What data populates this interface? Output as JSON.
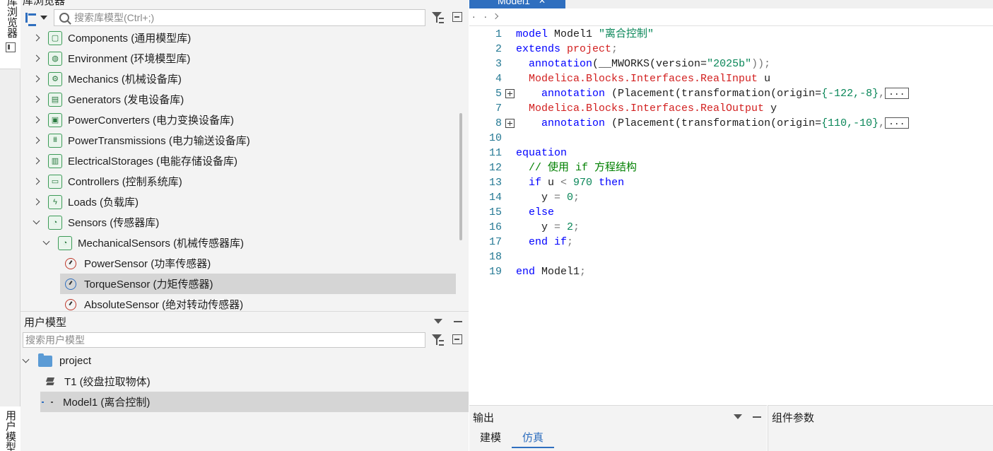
{
  "left_tabs": {
    "library_browser": "库浏览器",
    "user_models": "用户模型"
  },
  "library": {
    "title": "库浏览器",
    "search_placeholder": "搜索库模型(Ctrl+;)",
    "items": [
      {
        "label": "Components (通用模型库)",
        "icon": "components-lib-icon",
        "state": "collapsed"
      },
      {
        "label": "Environment (环境模型库)",
        "icon": "environment-lib-icon",
        "state": "collapsed"
      },
      {
        "label": "Mechanics (机械设备库)",
        "icon": "mechanics-lib-icon",
        "state": "collapsed"
      },
      {
        "label": "Generators (发电设备库)",
        "icon": "generators-lib-icon",
        "state": "collapsed"
      },
      {
        "label": "PowerConverters (电力变换设备库)",
        "icon": "powerconverters-lib-icon",
        "state": "collapsed"
      },
      {
        "label": "PowerTransmissions (电力输送设备库)",
        "icon": "powertransmissions-lib-icon",
        "state": "collapsed"
      },
      {
        "label": "ElectricalStorages (电能存储设备库)",
        "icon": "electricalstorages-lib-icon",
        "state": "collapsed"
      },
      {
        "label": "Controllers (控制系统库)",
        "icon": "controllers-lib-icon",
        "state": "collapsed"
      },
      {
        "label": "Loads (负载库)",
        "icon": "loads-lib-icon",
        "state": "collapsed"
      },
      {
        "label": "Sensors (传感器库)",
        "icon": "sensors-lib-icon",
        "state": "expanded"
      },
      {
        "label": "MechanicalSensors (机械传感器库)",
        "icon": "mechanicalsensors-lib-icon",
        "state": "expanded"
      },
      {
        "label": "PowerSensor (功率传感器)",
        "icon": "power-sensor-icon",
        "state": "leaf"
      },
      {
        "label": "TorqueSensor (力矩传感器)",
        "icon": "torque-sensor-icon",
        "state": "selected"
      },
      {
        "label": "AbsoluteSensor (绝对转动传感器)",
        "icon": "absolute-sensor-icon",
        "state": "leaf"
      }
    ]
  },
  "user_models": {
    "title": "用户模型",
    "search_placeholder": "搜索用户模型",
    "items": [
      {
        "label": "project",
        "icon": "folder-icon",
        "state": "expanded"
      },
      {
        "label": "T1 (绞盘拉取物体)",
        "icon": "layers-icon",
        "state": "leaf"
      },
      {
        "label": "Model1 (离合控制)",
        "icon": "model-icon",
        "state": "selected"
      }
    ]
  },
  "editor": {
    "tab_label": "Model1",
    "breadcrumb": "· ·",
    "line_numbers": [
      "1",
      "2",
      "3",
      "4",
      "5",
      "7",
      "8",
      "10",
      "11",
      "12",
      "13",
      "14",
      "15",
      "16",
      "17",
      "18",
      "19"
    ],
    "lines": {
      "l1a": "model",
      "l1b": " Model1 ",
      "l1c": "\"离合控制\"",
      "l2a": "extends",
      "l2b": " project",
      "l2c": ";",
      "l3a": "  annotation",
      "l3b": "(__MWORKS(version=",
      "l3c": "\"2025b\"",
      "l3d": "));",
      "l4a": "  Modelica.Blocks.Interfaces.RealInput",
      "l4b": " u",
      "l5a": "    annotation",
      "l5b": " (Placement(transformation(origin=",
      "l5c": "{-122,-8}",
      "l5d": ",",
      "l7a": "  Modelica.Blocks.Interfaces.RealOutput",
      "l7b": " y",
      "l8a": "    annotation",
      "l8b": " (Placement(transformation(origin=",
      "l8c": "{110,-10}",
      "l8d": ",",
      "ellipsis": "...",
      "l11": "equation",
      "l12": "  // 使用 if 方程结构",
      "l13a": "  if",
      "l13b": " u ",
      "l13c": "<",
      "l13d": " 970 ",
      "l13e": "then",
      "l14a": "    y ",
      "l14b": "=",
      "l14c": " 0",
      "l14d": ";",
      "l15": "  else",
      "l16a": "    y ",
      "l16b": "=",
      "l16c": " 2",
      "l16d": ";",
      "l17a": "  end if",
      "l17b": ";",
      "l19a": "end",
      "l19b": " Model1",
      "l19c": ";"
    }
  },
  "output": {
    "title": "输出",
    "tabs": [
      "建模",
      "仿真"
    ],
    "active_tab": "仿真"
  },
  "params": {
    "title": "组件参数"
  },
  "colors": {
    "accent": "#2f6fbf",
    "keyword": "#0000ff",
    "type": "#d21f1f",
    "string": "#098658",
    "comment": "#008000",
    "line_number": "#237893",
    "selection": "#d5d5d5"
  }
}
